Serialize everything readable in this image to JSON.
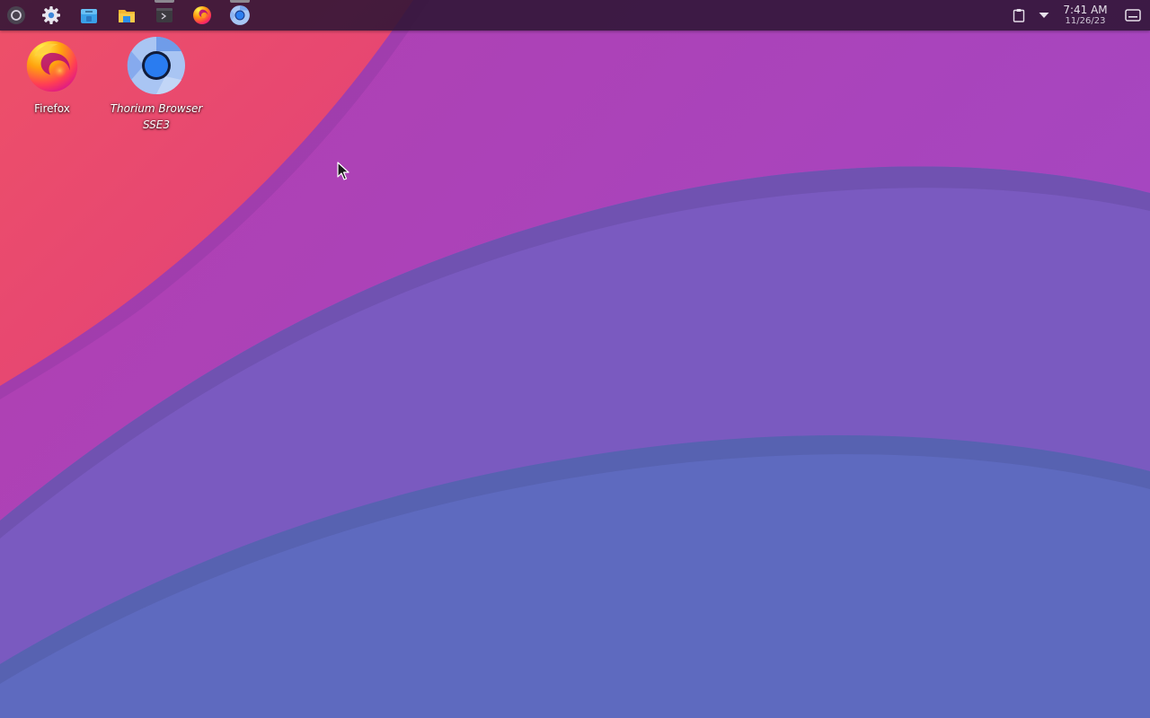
{
  "taskbar": {
    "launchers": [
      {
        "name": "application-menu",
        "icon": "app-menu-icon",
        "running": false
      },
      {
        "name": "system-settings",
        "icon": "gear-icon",
        "running": false
      },
      {
        "name": "discover-store",
        "icon": "store-icon",
        "running": false
      },
      {
        "name": "file-manager",
        "icon": "folder-icon",
        "running": false
      },
      {
        "name": "terminal",
        "icon": "terminal-icon",
        "running": true
      },
      {
        "name": "firefox",
        "icon": "firefox-icon",
        "running": false
      },
      {
        "name": "thorium-browser",
        "icon": "thorium-icon",
        "running": true
      }
    ],
    "tray": {
      "clipboard_icon": "clipboard-icon",
      "expand_icon": "chevron-down-icon",
      "time": "7:41 AM",
      "date": "11/26/23",
      "show_desktop_icon": "show-desktop-icon"
    }
  },
  "desktop": {
    "icons": [
      {
        "label": "Firefox",
        "icon": "firefox-icon"
      },
      {
        "label": "Thorium Browser SSE3",
        "icon": "thorium-icon"
      }
    ]
  },
  "colors": {
    "panel": "#2d1434",
    "wallpaper_pink": "#ec4474",
    "wallpaper_magenta": "#a946bc",
    "wallpaper_violet": "#7a5ac0",
    "wallpaper_blue": "#5e6abf"
  }
}
